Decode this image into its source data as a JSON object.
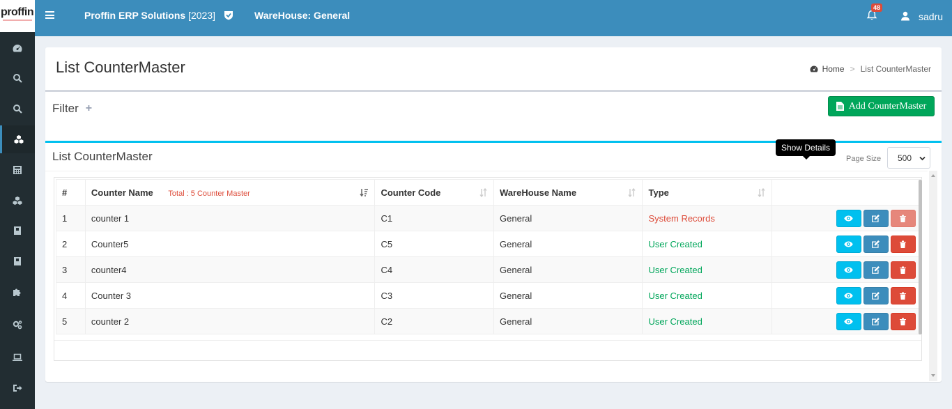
{
  "app": {
    "logo_text": "proffin",
    "brand": "Proffin ERP Solutions",
    "year": "[2023]",
    "warehouse": "WareHouse: General",
    "notification_count": "48",
    "username": "sadru"
  },
  "sidebar": {
    "items": [
      {
        "icon": "dashboard-icon"
      },
      {
        "icon": "search-icon"
      },
      {
        "icon": "search-icon"
      },
      {
        "icon": "cubes-icon",
        "active": true
      },
      {
        "icon": "calculator-icon"
      },
      {
        "icon": "cubes-icon"
      },
      {
        "icon": "book-icon"
      },
      {
        "icon": "book-icon"
      },
      {
        "icon": "puzzle-icon"
      },
      {
        "icon": "cogs-icon"
      },
      {
        "icon": "laptop-icon"
      },
      {
        "icon": "sign-out-icon"
      }
    ]
  },
  "page": {
    "title": "List CounterMaster",
    "breadcrumb_home": "Home",
    "breadcrumb_sep": ">",
    "breadcrumb_current": "List CounterMaster"
  },
  "filter": {
    "label": "Filter",
    "toggle": "+"
  },
  "add_button": "Add CounterMaster",
  "list": {
    "title": "List CounterMaster",
    "page_size_label": "Page Size",
    "page_size_value": "500",
    "total_text": "Total : 5 Counter Master",
    "columns": [
      "#",
      "Counter Name",
      "Counter Code",
      "WareHouse Name",
      "Type"
    ],
    "rows": [
      {
        "no": "1",
        "name": "counter 1",
        "code": "C1",
        "warehouse": "General",
        "type": "System Records"
      },
      {
        "no": "2",
        "name": "Counter5",
        "code": "C5",
        "warehouse": "General",
        "type": "User Created"
      },
      {
        "no": "3",
        "name": "counter4",
        "code": "C4",
        "warehouse": "General",
        "type": "User Created"
      },
      {
        "no": "4",
        "name": "Counter 3",
        "code": "C3",
        "warehouse": "General",
        "type": "User Created"
      },
      {
        "no": "5",
        "name": "counter 2",
        "code": "C2",
        "warehouse": "General",
        "type": "User Created"
      }
    ]
  },
  "tooltip": "Show Details",
  "colors": {
    "header": "#3c8dbc",
    "sidebar": "#222d32",
    "success": "#00a65a",
    "info": "#00c0ef",
    "danger": "#dd4b39"
  }
}
